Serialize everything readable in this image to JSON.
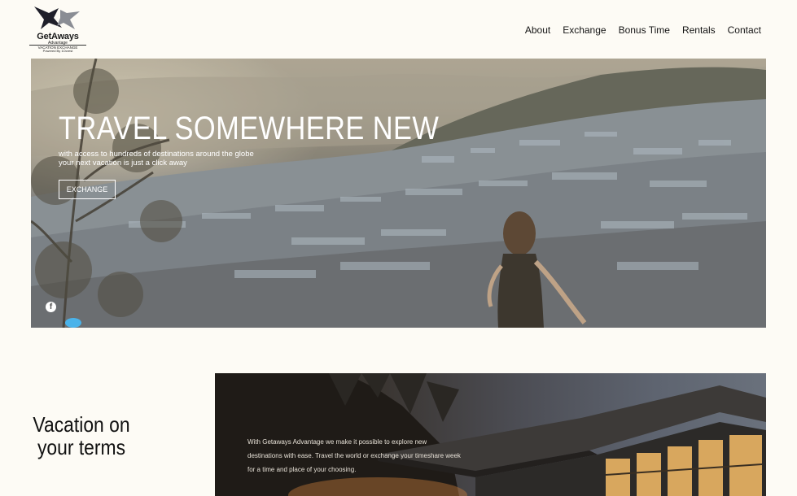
{
  "header": {
    "logo": {
      "name": "GetAways",
      "tagline": "Advantage",
      "line2": "VACATION EXCHANGE",
      "line3": "Powered By 1Ocrest",
      "icon": "arrows-logo-icon"
    },
    "nav": [
      "About",
      "Exchange",
      "Bonus Time",
      "Rentals",
      "Contact"
    ]
  },
  "hero": {
    "title": "TRAVEL SOMEWHERE NEW",
    "subtitle_line1": "with access to hundreds of destinations around the globe",
    "subtitle_line2": "your next vacation is just a click away",
    "button_label": "EXCHANGE",
    "social_icon": "facebook-icon"
  },
  "section": {
    "title_line1": "Vacation on",
    "title_line2": "your terms",
    "body_line1": "With Getaways Advantage we make it possible to explore new",
    "body_line2": "destinations with ease. Travel the world or exchange your timeshare week",
    "body_line3": "for a time and place of your choosing."
  },
  "colors": {
    "background": "#fdfbf5",
    "text": "#1b1b1b",
    "hero_text": "#ffffff"
  }
}
